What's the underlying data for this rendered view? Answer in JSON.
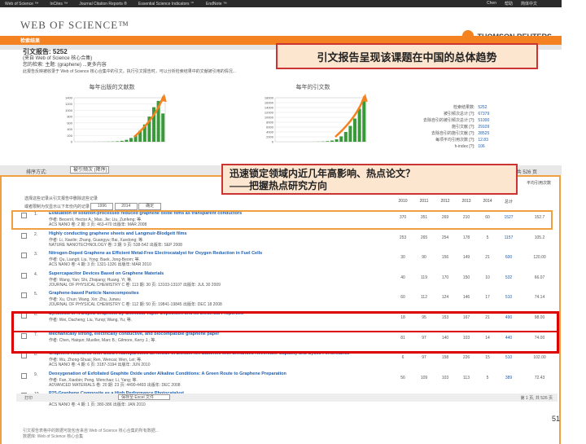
{
  "topbar": {
    "items": [
      "Web of Science ™",
      "InCites ™",
      "Journal Citation Reports ®",
      "Essential Science Indicators ℠",
      "EndNote ™"
    ],
    "right": [
      "Chen",
      "帮助",
      "简体中文"
    ]
  },
  "header": {
    "logo": "WEB OF SCIENCE™",
    "brand": "THOMSON REUTERS"
  },
  "nav": {
    "tab": "检索结果"
  },
  "report": {
    "title": "引文报告: 5252",
    "subtitle": "(来自 Web of Science 核心合集)",
    "query": "您的检索: 主题: (graphene) ...更多内容",
    "info": "此报告反映被收录于 Web of Science 核心合集中的引文。执行引文报告时，可以分析检索结果中的文献被引用的情况..."
  },
  "callout1": "引文报告呈现该课题在中国的总体趋势",
  "charts": [
    {
      "title": "每年出版的文献数",
      "ylim": [
        0,
        1400
      ],
      "yticks": [
        0,
        200,
        400,
        600,
        800,
        1000,
        1200,
        1400
      ],
      "values": [
        1,
        1,
        1,
        1,
        2,
        2,
        3,
        5,
        8,
        15,
        30,
        60,
        120,
        200,
        350,
        550,
        800,
        1100,
        1300,
        900
      ]
    },
    {
      "title": "每年的引文数",
      "ylim": [
        0,
        18000
      ],
      "yticks": [
        0,
        2000,
        4000,
        6000,
        8000,
        10000,
        12000,
        14000,
        16000,
        18000
      ],
      "values": [
        1,
        1,
        1,
        1,
        2,
        3,
        5,
        10,
        20,
        50,
        100,
        250,
        500,
        1000,
        2200,
        4000,
        6500,
        9500,
        13500,
        16500
      ]
    }
  ],
  "stats": [
    {
      "label": "检索结果数:",
      "value": "5252"
    },
    {
      "label": "被引频次总计 [?]:",
      "value": "67379"
    },
    {
      "label": "去除自引的被引频次总计 [?]:",
      "value": "51000"
    },
    {
      "label": "施引文献 [?]:",
      "value": "29109"
    },
    {
      "label": "去除自引的施引文献 [?]:",
      "value": "28525"
    },
    {
      "label": "每项平均引用次数 [?]:",
      "value": "12.83"
    },
    {
      "label": "h-index [?]:",
      "value": "106"
    }
  ],
  "sort": {
    "label": "排序方式:",
    "value": "被引频次 (降序)",
    "pager": "第 1 页, 共 526 页"
  },
  "callout2": {
    "line1": "迅速锁定领域内近几年高影响、热点论文？",
    "line2": "——把握热点研究方向"
  },
  "table": {
    "note1": "选择这些记录从引文报告中删除这些记录",
    "note2": "或者限制为仅显示以下年份内的记录",
    "year_from": "1996",
    "year_to": "2014",
    "go": "确定",
    "avg_header": "平均引用次数",
    "year_headers": [
      "2010",
      "2011",
      "2012",
      "2013",
      "2014",
      "总计"
    ],
    "rows": [
      {
        "n": "1.",
        "title": "Evaluation of solution-processed reduced graphene oxide films as transparent conductors",
        "l2": "作者: Becerril, Hector A.; Mao, Jie; Liu, Zunfeng; 等.",
        "l3": "ACS NANO 卷: 2 期: 3 页: 463-470 出版年: MAR 2008",
        "c": [
          "370",
          "351",
          "269",
          "210",
          "60",
          "1527",
          "152.7"
        ]
      },
      {
        "n": "2.",
        "title": "Highly conducting graphene sheets and Langmuir-Blodgett films",
        "l2": "作者: Li, Xiaolin; Zhang, Guangyu; Bai, Xuedong; 等.",
        "l3": "NATURE NANOTECHNOLOGY 卷: 3 期: 9 页: 538-542 出版年: SEP 2008",
        "c": [
          "253",
          "265",
          "254",
          "178",
          "5",
          "1157",
          "105.2"
        ]
      },
      {
        "n": "3.",
        "title": "Nitrogen-Doped Graphene as Efficient Metal-Free Electrocatalyst for Oxygen Reduction in Fuel Cells",
        "l2": "作者: Qu, Liangti; Liu, Yong; Baek, Jong-Beom; 等.",
        "l3": "ACS NANO 卷: 4 期: 3 页: 1321-1326 出版年: MAR 2010",
        "c": [
          "30",
          "90",
          "156",
          "149",
          "21",
          "600",
          "120.00"
        ]
      },
      {
        "n": "4.",
        "title": "Supercapacitor Devices Based on Graphene Materials",
        "l2": "作者: Wang, Yan; Shi, Zhiqiang; Huang, Yi; 等.",
        "l3": "JOURNAL OF PHYSICAL CHEMISTRY C 卷: 113 期: 30 页: 13103-13107 出版年: JUL 30 2009",
        "c": [
          "40",
          "119",
          "170",
          "150",
          "10",
          "532",
          "66.07"
        ]
      },
      {
        "n": "5.",
        "title": "Graphene-based Particle Nanocomposites",
        "l2": "作者: Xu, Chun; Wang, Xin; Zhu, Junwu",
        "l3": "JOURNAL OF PHYSICAL CHEMISTRY C 卷: 112 期: 50 页: 19841-19845 出版年: DEC 18 2008",
        "c": [
          "60",
          "112",
          "124",
          "146",
          "17",
          "510",
          "74.14"
        ]
      },
      {
        "n": "6.",
        "title": "Synthesis of N-Doped Graphene by Chemical Vapor Deposition and Its Electrical Properties",
        "l2": "作者: Wei, Dacheng; Liu, Yunqi; Wang, Yu; 等.",
        "l3": "",
        "c": [
          "18",
          "95",
          "153",
          "167",
          "21",
          "490",
          "98.00"
        ]
      },
      {
        "n": "7.",
        "title": "Mechanically strong, electrically conductive, and biocompatible graphene paper",
        "l2": "作者: Chen, Haiqun; Mueller, Marc B.; Gilmore, Kerry J.; 等.",
        "l3": "",
        "c": [
          "81",
          "97",
          "140",
          "103",
          "14",
          "440",
          "74.00"
        ]
      },
      {
        "n": "8.",
        "title": "Graphene Anchored with Co3O4 Nanoparticles as Anode of Lithium Ion Batteries with Enhanced Reversible Capacity and Cyclic Performance",
        "l2": "作者: Wu, Zhong-Shuai; Ren, Wencai; Wen, Lei; 等.",
        "l3": "ACS NANO 卷: 4 期: 6 页: 3187-3194 出版年: JUN 2010",
        "c": [
          "6",
          "97",
          "158",
          "226",
          "15",
          "510",
          "102.00"
        ]
      },
      {
        "n": "9.",
        "title": "Deoxygenation of Exfoliated Graphite Oxide under Alkaline Conditions: A Green Route to Graphene Preparation",
        "l2": "作者: Fan, Xiaobin; Peng, Wenchao; Li, Yang; 等.",
        "l3": "ADVANCED MATERIALS 卷: 20 期: 23 页: 4490-4493 出版年: DEC 2008",
        "c": [
          "56",
          "109",
          "103",
          "113",
          "5",
          "389",
          "72.43"
        ]
      },
      {
        "n": "10.",
        "title": "P25-Graphene Composite as a High Performance Photocatalyst",
        "l2": "作者: Zhang, Hao; Lv, Xiaojun; Li, Yueming; 等.",
        "l3": "ACS NANO 卷: 4 期: 1 页: 380-386 出版年: JAN 2010",
        "c": [
          "21",
          "80",
          "123",
          "101",
          "20",
          "350",
          "70.00"
        ]
      }
    ]
  },
  "bottom": {
    "print": "打印",
    "save": "保存至 Excel 文件",
    "pager": "第 1 页, 共 526 页"
  },
  "page_number": "51",
  "footer": {
    "line1": "引文报告表格中的数据可能包含来自 Web of Science 核心合集的所有数据...",
    "line2": "数据库: Web of Science 核心合集"
  }
}
